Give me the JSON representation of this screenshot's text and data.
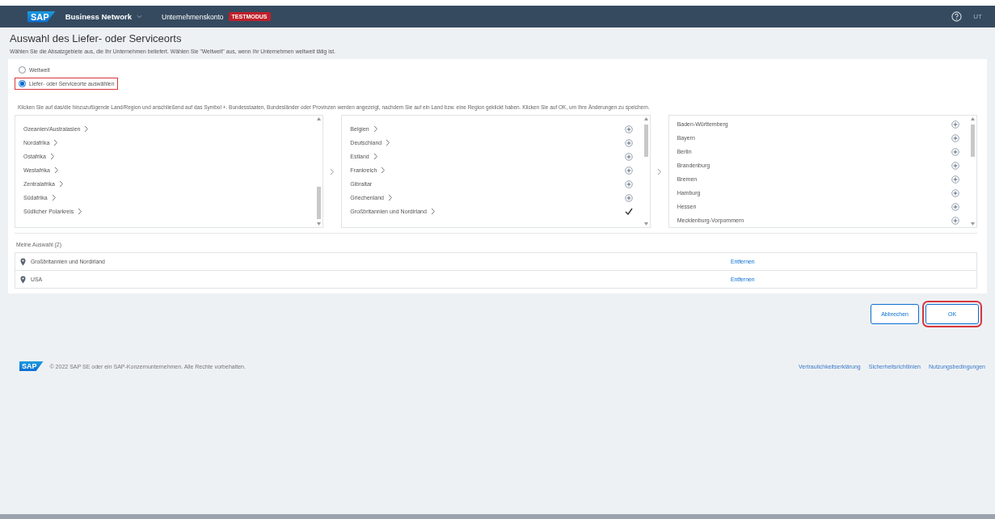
{
  "header": {
    "logo": "SAP",
    "product": "Business Network",
    "account": "Unternehmenskonto",
    "badge": "TESTMODUS",
    "user_initials": "UT"
  },
  "page": {
    "title": "Auswahl des Liefer- oder Serviceorts",
    "subtitle": "Wählen Sie die Absatzgebiete aus, die Ihr Unternehmen beliefert. Wählen Sie \"Weltweit\" aus, wenn Ihr Unternehmen weltweit tätig ist."
  },
  "radios": [
    {
      "label": "Weltweit",
      "selected": false,
      "highlighted": false
    },
    {
      "label": "Liefer- oder Serviceorte auswählen",
      "selected": true,
      "highlighted": true
    }
  ],
  "instruction": "Klicken Sie auf das/die hinzuzufügende Land/Region und anschließend auf das Symbol +. Bundesstaaten, Bundesländer oder Provinzen werden angezeigt, nachdem Sie auf ein Land bzw. eine Region geklickt haben. Klicken Sie auf OK, um Ihre Änderungen zu speichern.",
  "lists": [
    {
      "items": [
        {
          "label": "Ozeanien/Australasien",
          "has_children": true
        },
        {
          "label": "Nordafrika",
          "has_children": true
        },
        {
          "label": "Ostafrika",
          "has_children": true
        },
        {
          "label": "Westafrika",
          "has_children": true
        },
        {
          "label": "Zentralafrika",
          "has_children": true
        },
        {
          "label": "Südafrika",
          "has_children": true
        },
        {
          "label": "Südlicher Polarkreis",
          "has_children": true
        }
      ]
    },
    {
      "items": [
        {
          "label": "Belgien",
          "has_children": true,
          "checked": false
        },
        {
          "label": "Deutschland",
          "has_children": true,
          "checked": false
        },
        {
          "label": "Estland",
          "has_children": true,
          "checked": false
        },
        {
          "label": "Frankreich",
          "has_children": true,
          "checked": false
        },
        {
          "label": "Gibraltar",
          "has_children": false,
          "checked": false
        },
        {
          "label": "Griechenland",
          "has_children": true,
          "checked": false
        },
        {
          "label": "Großbritannien und Nordirland",
          "has_children": true,
          "checked": true
        }
      ]
    },
    {
      "items": [
        {
          "label": "Baden-Württemberg",
          "has_children": false,
          "checked": false
        },
        {
          "label": "Bayern",
          "has_children": false,
          "checked": false
        },
        {
          "label": "Berlin",
          "has_children": false,
          "checked": false
        },
        {
          "label": "Brandenburg",
          "has_children": false,
          "checked": false
        },
        {
          "label": "Bremen",
          "has_children": false,
          "checked": false
        },
        {
          "label": "Hamburg",
          "has_children": false,
          "checked": false
        },
        {
          "label": "Hessen",
          "has_children": false,
          "checked": false
        },
        {
          "label": "Mecklenburg-Vorpommern",
          "has_children": false,
          "checked": false
        }
      ]
    }
  ],
  "selection": {
    "title": "Meine Auswahl (2)",
    "items": [
      {
        "label": "Großbritannien und Nordirland",
        "action": "Entfernen"
      },
      {
        "label": "USA",
        "action": "Entfernen"
      }
    ]
  },
  "buttons": [
    {
      "label": "Abbrechen",
      "highlighted": false
    },
    {
      "label": "OK",
      "highlighted": true
    }
  ],
  "footer": {
    "logo": "SAP",
    "copyright": "© 2022 SAP SE oder ein SAP-Konzernunternehmen. Alle Rechte vorbehalten.",
    "links": [
      "Vertraulichkeitserklärung",
      "Sicherheitsrichtlinien",
      "Nutzungsbedingungen"
    ]
  }
}
